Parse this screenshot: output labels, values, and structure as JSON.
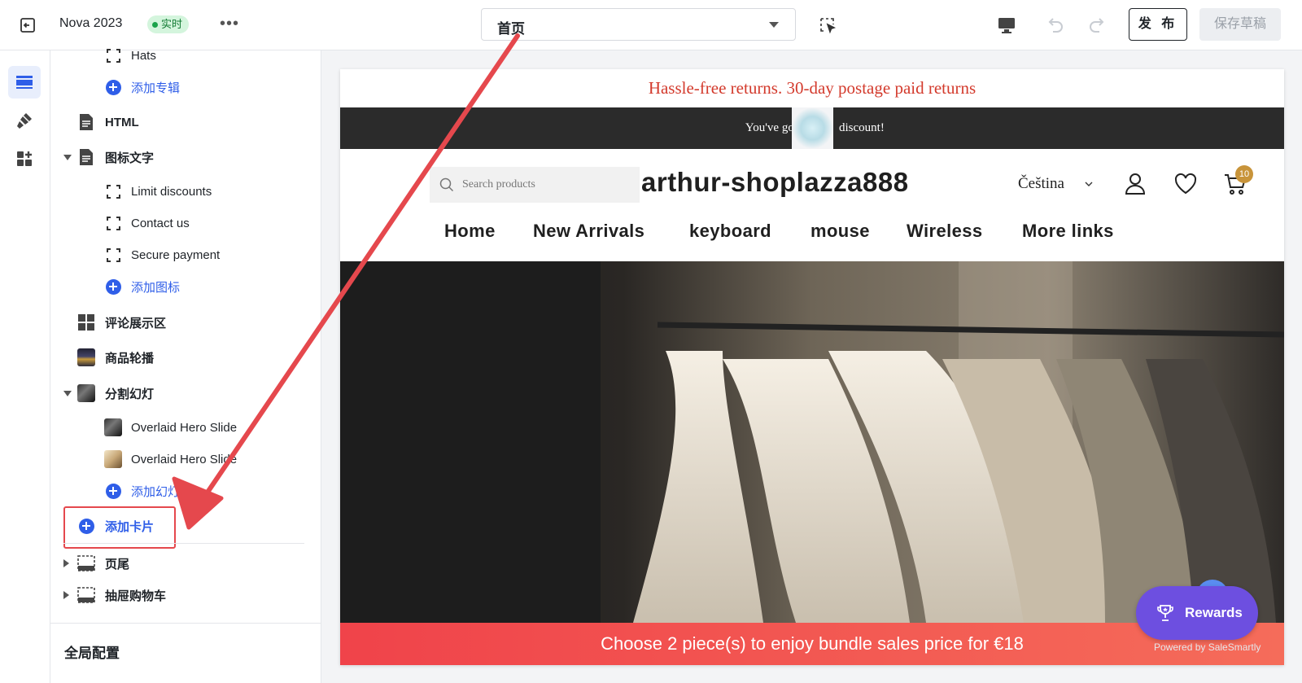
{
  "topbar": {
    "title": "Nova 2023",
    "badge": "实时",
    "more": "•••",
    "page_select": "首页",
    "publish": "发 布",
    "save_draft": "保存草稿"
  },
  "sidebar": {
    "hats": "Hats",
    "add_collection": "添加专辑",
    "html": "HTML",
    "icon_text": "图标文字",
    "limit_discounts": "Limit discounts",
    "contact_us": "Contact us",
    "secure_payment": "Secure payment",
    "add_icon": "添加图标",
    "reviews": "评论展示区",
    "product_carousel": "商品轮播",
    "split_slides": "分割幻灯",
    "overlaid_hero_1": "Overlaid Hero Slide",
    "overlaid_hero_2": "Overlaid Hero Slide",
    "add_slide": "添加幻灯",
    "add_card": "添加卡片",
    "footer": "页尾",
    "drawer_cart": "抽屉购物车",
    "global_config": "全局配置"
  },
  "preview": {
    "announcement": "Hassle-free returns. 30-day postage paid returns",
    "discount_left": "You've got",
    "discount_right": "discount!",
    "search_placeholder": "Search products",
    "store_name": "arthur-shoplazza888",
    "language": "Čeština",
    "cart_count": "10",
    "nav": [
      "Home",
      "New Arrivals",
      "keyboard",
      "mouse",
      "Wireless",
      "More links"
    ],
    "bundle": "Choose 2 piece(s) to enjoy bundle sales price for €18",
    "rewards": "Rewards",
    "powered_by": "Powered by SaleSmartly"
  },
  "colors": {
    "accent": "#2f5ee8",
    "annotation_red": "#e5484d",
    "announce_red": "#d33a2c",
    "rewards_purple": "#6d4fe0"
  }
}
